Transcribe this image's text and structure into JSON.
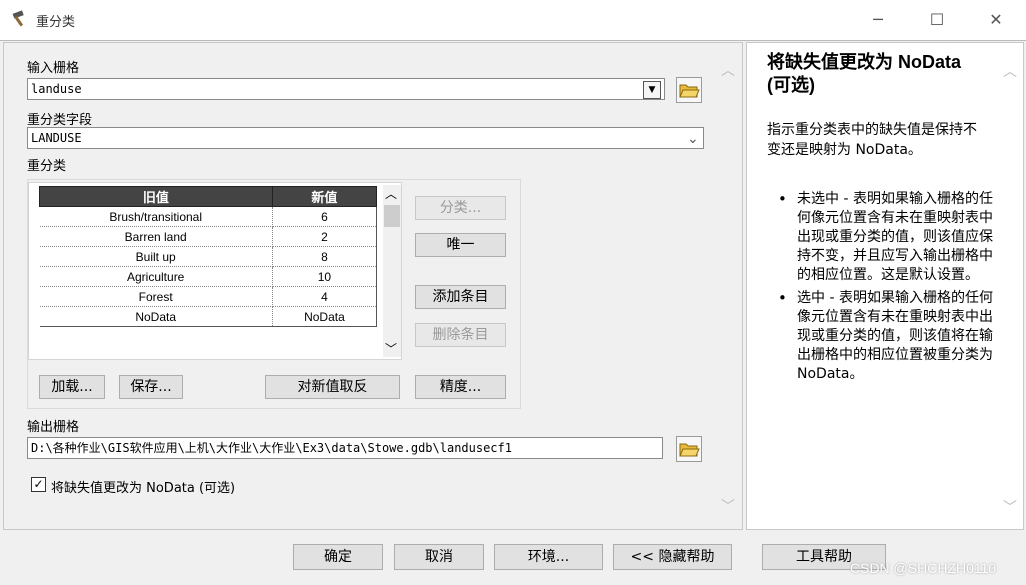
{
  "window": {
    "title": "重分类",
    "minimize_glyph": "─",
    "maximize_glyph": "☐",
    "close_glyph": "✕"
  },
  "form": {
    "input_raster_label": "输入栅格",
    "input_raster_value": "landuse",
    "field_label": "重分类字段",
    "field_value": "LANDUSE",
    "reclass_label": "重分类",
    "table": {
      "headers": [
        "旧值",
        "新值"
      ],
      "rows": [
        {
          "old": "Brush/transitional",
          "new": "6"
        },
        {
          "old": "Barren land",
          "new": "2"
        },
        {
          "old": "Built up",
          "new": "8"
        },
        {
          "old": "Agriculture",
          "new": "10"
        },
        {
          "old": "Forest",
          "new": "4"
        },
        {
          "old": "NoData",
          "new": "NoData"
        }
      ]
    },
    "buttons": {
      "classify": "分类...",
      "unique": "唯一",
      "add_entry": "添加条目",
      "delete_entry": "删除条目",
      "load": "加载...",
      "save": "保存...",
      "reverse": "对新值取反",
      "precision": "精度..."
    },
    "output_raster_label": "输出栅格",
    "output_raster_value": "D:\\各种作业\\GIS软件应用\\上机\\大作业\\大作业\\Ex3\\data\\Stowe.gdb\\landusecf1",
    "nodata_checkbox_label": "将缺失值更改为 NoData (可选)",
    "nodata_checked": true
  },
  "help": {
    "title": "将缺失值更改为 NoData (可选)",
    "intro": "指示重分类表中的缺失值是保持不变还是映射为 NoData。",
    "bullets": [
      "未选中 - 表明如果输入栅格的任何像元位置含有未在重映射表中出现或重分类的值，则该值应保持不变，并且应写入输出栅格中的相应位置。这是默认设置。",
      "选中 - 表明如果输入栅格的任何像元位置含有未在重映射表中出现或重分类的值，则该值将在输出栅格中的相应位置被重分类为 NoData。"
    ]
  },
  "footer": {
    "ok": "确定",
    "cancel": "取消",
    "environments": "环境...",
    "hide_help": "<< 隐藏帮助",
    "tool_help": "工具帮助"
  },
  "watermark": "CSDN @SHCHZH0110",
  "icons": [
    "hammer-icon",
    "folder-open-icon",
    "dropdown-arrow-icon",
    "chevron-up-icon",
    "chevron-down-icon",
    "checkmark-icon"
  ],
  "colors": {
    "table_header_bg": "#444444",
    "panel_bg": "#f0f0f0",
    "folder_yellow": "#e8b93a"
  }
}
